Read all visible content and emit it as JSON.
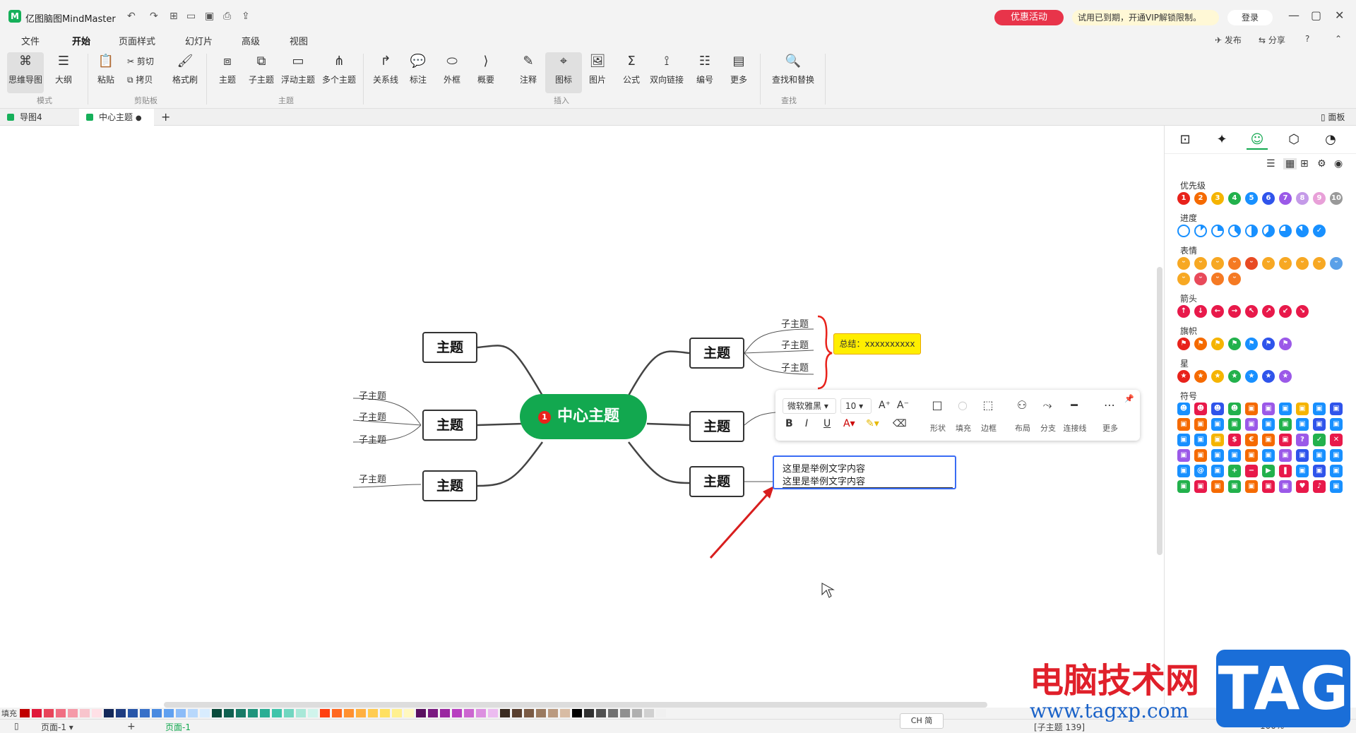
{
  "app": {
    "title": "亿图脑图MindMaster",
    "logo": "M",
    "promo": "优惠活动",
    "vip": "试用已到期，开通VIP解锁限制。",
    "login": "登录",
    "publish": "发布",
    "share": "分享",
    "help": "?"
  },
  "menus": [
    "文件",
    "开始",
    "页面样式",
    "幻灯片",
    "高级",
    "视图"
  ],
  "ribbon": {
    "mode": {
      "b1": "思维导图",
      "b2": "大纲",
      "group": "模式"
    },
    "clip": {
      "paste": "粘贴",
      "cut": "剪切",
      "copy": "拷贝",
      "format": "格式刷",
      "group": "剪贴板"
    },
    "topic": {
      "t1": "主题",
      "t2": "子主题",
      "t3": "浮动主题",
      "t4": "多个主题",
      "group": "主题"
    },
    "insert": {
      "i1": "关系线",
      "i2": "标注",
      "i3": "外框",
      "i4": "概要",
      "i5": "注释",
      "i6": "图标",
      "i7": "图片",
      "i8": "公式",
      "i9": "双向链接",
      "i10": "编号",
      "i11": "更多",
      "group": "插入"
    },
    "find": {
      "f1": "查找和替换",
      "group": "查找"
    }
  },
  "tabs": {
    "t1": "导图4",
    "t2": "中心主题",
    "panel": "面板"
  },
  "map": {
    "central": "中心主题",
    "badge": "1",
    "topic": "主题",
    "sub": "子主题",
    "summary": "总结：xxxxxxxxxx",
    "edit1": "这里是举例文字内容",
    "edit2": "这里是举例文字内容"
  },
  "ftool": {
    "font": "微软雅黑",
    "size": "10",
    "shape": "形状",
    "fill": "填充",
    "border": "边框",
    "layout": "布局",
    "branch": "分支",
    "connector": "连接线",
    "more": "更多"
  },
  "panel": {
    "s1": "优先级",
    "s2": "进度",
    "s3": "表情",
    "s4": "箭头",
    "s5": "旗帜",
    "s6": "星",
    "s7": "符号"
  },
  "status": {
    "fill": "填充",
    "page": "页面-1",
    "pagetab": "页面-1",
    "count": "[子主题 139]",
    "zoom": "100%",
    "ime": "CH 简"
  },
  "watermark": {
    "cn": "电脑技术网",
    "url": "www.tagxp.com",
    "tag": "TAG"
  },
  "colors": {
    "accent": "#12a84f",
    "promo": "#e8344a",
    "select": "#3a6cf4"
  }
}
